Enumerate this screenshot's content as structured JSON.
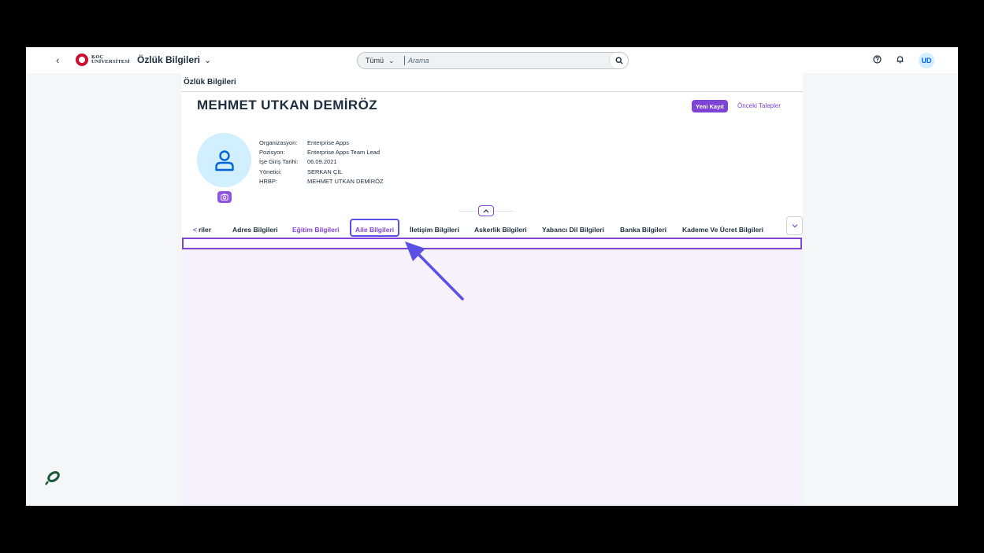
{
  "shellbar": {
    "back_glyph": "‹",
    "logo_line1": "KOÇ",
    "logo_line2": "ÜNİVERSİTESİ",
    "app_title": "Özlük Bilgileri",
    "app_title_chevron": "⌄",
    "search_scope": "Tümü",
    "search_scope_chevron": "⌄",
    "search_placeholder": "Arama",
    "avatar_initials": "UD"
  },
  "breadcrumb": "Özlük Bilgileri",
  "employee": {
    "name": "MEHMET UTKAN DEMİRÖZ",
    "fields": [
      {
        "label": "Organizasyon:",
        "value": "Enterprise Apps"
      },
      {
        "label": "Pozisyon:",
        "value": "Enterprise Apps Team Lead"
      },
      {
        "label": "İşe Giriş Tarihi:",
        "value": "06.09.2021"
      },
      {
        "label": "Yönetici:",
        "value": "SERKAN ÇİL"
      },
      {
        "label": "HRBP:",
        "value": "MEHMET UTKAN DEMİRÖZ"
      }
    ]
  },
  "actions": {
    "new_record": "Yeni Kayıt",
    "previous_requests": "Önceki Talepler"
  },
  "tabs": {
    "left_arrow": "<",
    "partial": "riler",
    "items": [
      {
        "label": "Adres Bilgileri"
      },
      {
        "label": "Eğitim Bilgileri"
      },
      {
        "label": "Aile Bilgileri"
      },
      {
        "label": "İletişim Bilgileri"
      },
      {
        "label": "Askerlik Bilgileri"
      },
      {
        "label": "Yabancı Dil Bilgileri"
      },
      {
        "label": "Banka Bilgileri"
      },
      {
        "label": "Kademe Ve Ücret Bilgileri"
      }
    ],
    "active_index": 1,
    "highlighted_index": 2
  },
  "colors": {
    "accent": "#7f44d6",
    "highlight": "#5a4fe6",
    "avatar_bg": "#d1efff"
  },
  "icons": [
    "back-icon",
    "search-icon",
    "help-icon",
    "bell-icon",
    "user-icon",
    "camera-icon",
    "chevron-up-icon",
    "chevron-down-icon",
    "extension-icon",
    "pointer-arrow"
  ]
}
